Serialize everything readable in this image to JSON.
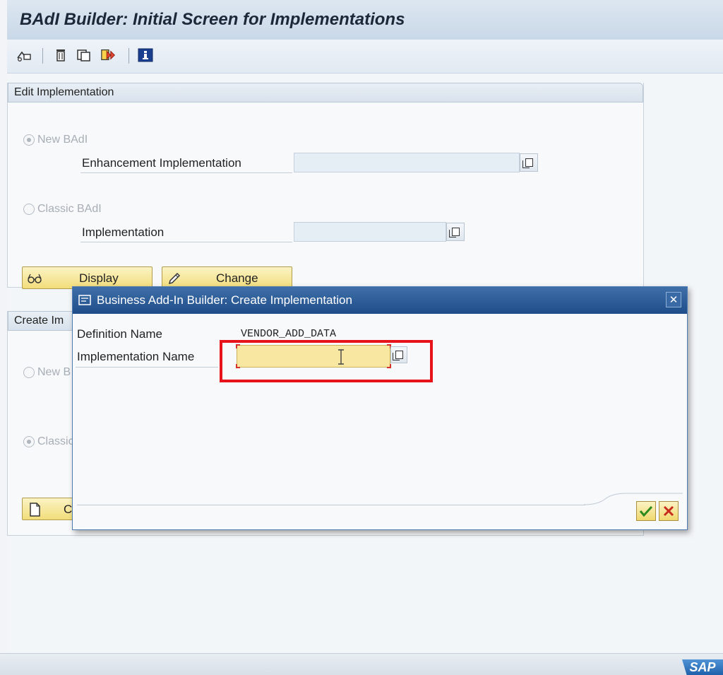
{
  "window": {
    "title": "BAdI Builder: Initial Screen for Implementations"
  },
  "toolbar": {
    "icons": [
      "other-object-icon",
      "delete-icon",
      "copy-icon",
      "where-used-icon",
      "info-icon"
    ]
  },
  "edit_group": {
    "header": "Edit Implementation",
    "new_badi_label": "New BAdI",
    "enhancement_impl_label": "Enhancement Implementation",
    "enhancement_impl_value": "",
    "classic_badi_label": "Classic BAdI",
    "implementation_label": "Implementation",
    "implementation_value": "",
    "display_button": "Display",
    "change_button": "Change"
  },
  "create_group": {
    "header_visible": "Create Im",
    "new_badi_visible": "New B",
    "classic_badi_visible": "Classic",
    "create_button_visible": "C"
  },
  "dialog": {
    "title": "Business Add-In Builder: Create Implementation",
    "definition_name_label": "Definition Name",
    "definition_name_value": "VENDOR_ADD_DATA",
    "implementation_name_label": "Implementation Name",
    "implementation_name_value": "",
    "close_icon": "close-icon",
    "ok_icon": "checkmark-icon",
    "cancel_icon": "cancel-x-icon"
  },
  "colors": {
    "highlight": "#e8131a",
    "dialog_title": "#1e4d8a",
    "button_yellow": "#f2dd7a"
  },
  "branding": {
    "logo_text": "SAP"
  }
}
